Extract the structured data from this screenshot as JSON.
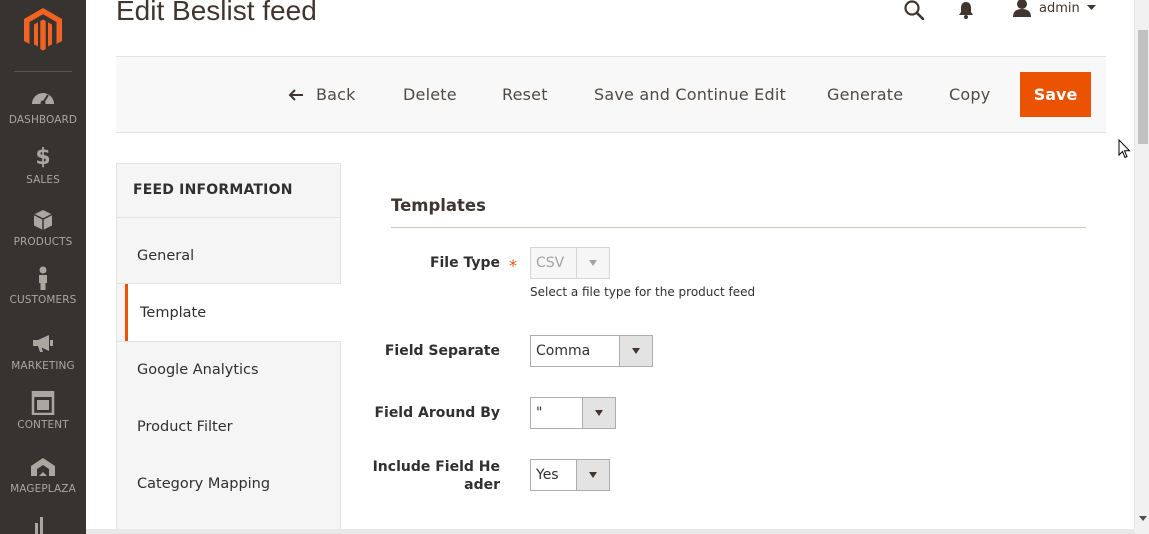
{
  "sidebar": {
    "items": [
      {
        "label": "DASHBOARD",
        "icon": "dashboard-icon"
      },
      {
        "label": "SALES",
        "icon": "dollar-icon"
      },
      {
        "label": "PRODUCTS",
        "icon": "cube-icon"
      },
      {
        "label": "CUSTOMERS",
        "icon": "person-icon"
      },
      {
        "label": "MARKETING",
        "icon": "megaphone-icon"
      },
      {
        "label": "CONTENT",
        "icon": "layout-icon"
      },
      {
        "label": "MAGEPLAZA",
        "icon": "mageplaza-icon"
      }
    ]
  },
  "header": {
    "title": "Edit Beslist feed",
    "user": "admin"
  },
  "actions": {
    "back": "Back",
    "delete": "Delete",
    "reset": "Reset",
    "save_continue": "Save and Continue Edit",
    "generate": "Generate",
    "copy": "Copy",
    "save": "Save"
  },
  "tabs": {
    "title": "FEED INFORMATION",
    "items": [
      "General",
      "Template",
      "Google Analytics",
      "Product Filter",
      "Category Mapping"
    ],
    "active": "Template"
  },
  "form": {
    "section_title": "Templates",
    "file_type": {
      "label": "File Type",
      "value": "CSV",
      "note": "Select a file type for the product feed",
      "required": true
    },
    "field_separate": {
      "label": "Field Separate",
      "value": "Comma"
    },
    "field_around_by": {
      "label": "Field Around By",
      "value": "\""
    },
    "include_field_header": {
      "label_line1": "Include Field He",
      "label_line2": "ader",
      "value": "Yes"
    }
  },
  "colors": {
    "accent": "#eb5202",
    "sidebar_bg": "#373330",
    "sidebar_text": "#aaa6a0"
  }
}
